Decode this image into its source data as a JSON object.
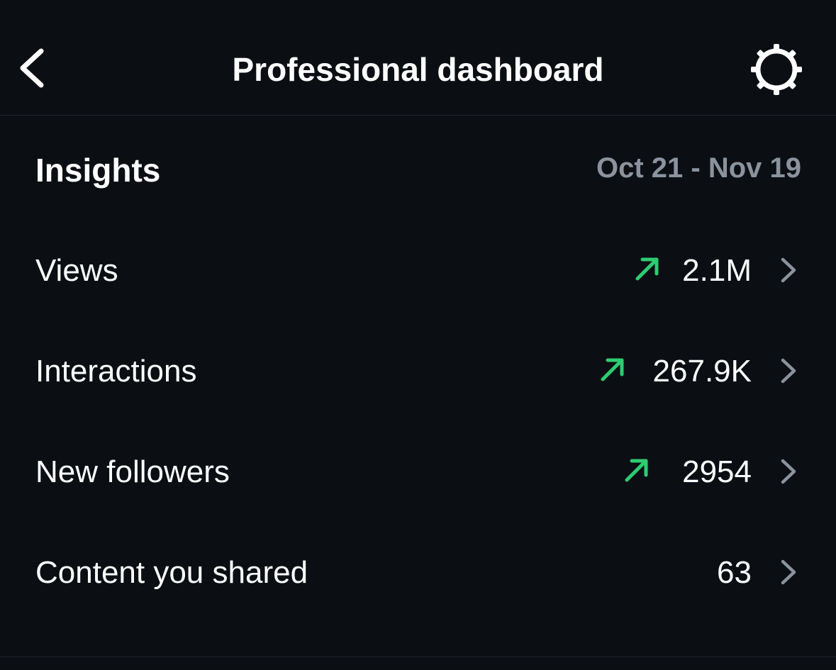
{
  "header": {
    "title": "Professional dashboard",
    "back_icon": "chevron-left-icon",
    "settings_icon": "gear-icon"
  },
  "insights": {
    "title": "Insights",
    "date_range": "Oct 21 - Nov 19",
    "rows": [
      {
        "label": "Views",
        "value": "2.1M",
        "trend": "up"
      },
      {
        "label": "Interactions",
        "value": "267.9K",
        "trend": "up"
      },
      {
        "label": "New followers",
        "value": "2954",
        "trend": "up"
      },
      {
        "label": "Content you shared",
        "value": "63",
        "trend": "none"
      }
    ]
  },
  "colors": {
    "background": "#0b0f14",
    "text": "#ffffff",
    "muted": "#8a939e",
    "trend_up": "#2ecc71",
    "chevron": "#8a939e",
    "divider": "#1f242b"
  }
}
